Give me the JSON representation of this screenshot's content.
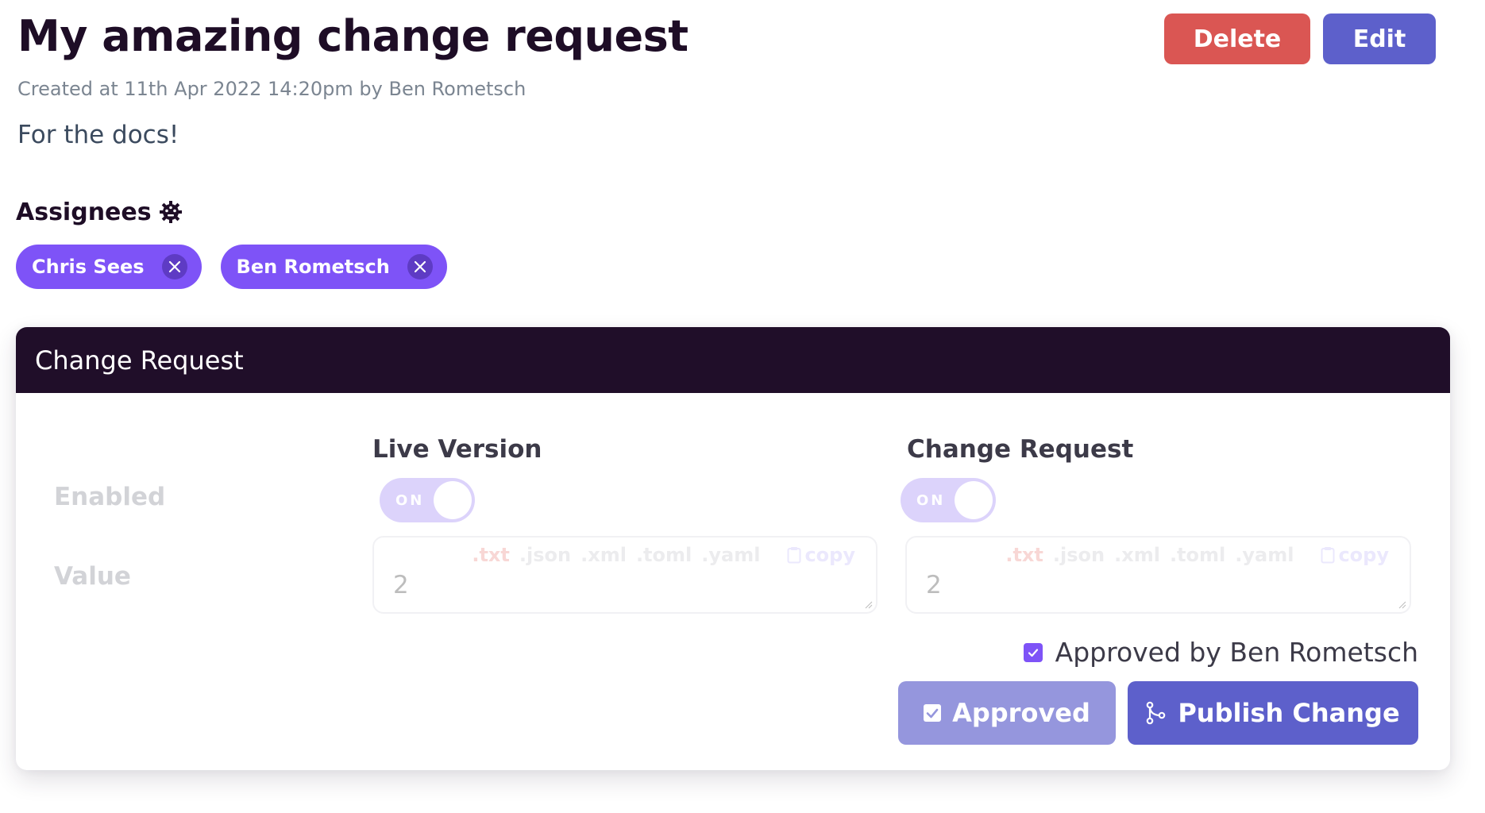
{
  "header": {
    "title": "My amazing change request",
    "created": "Created at 11th Apr 2022 14:20pm by Ben Rometsch",
    "description": "For the docs!",
    "delete_label": "Delete",
    "edit_label": "Edit"
  },
  "assignees": {
    "label": "Assignees",
    "settings_icon": "gear-icon",
    "people": [
      {
        "name": "Chris Sees"
      },
      {
        "name": "Ben Rometsch"
      }
    ]
  },
  "card": {
    "title": "Change Request",
    "rows": {
      "enabled_label": "Enabled",
      "value_label": "Value"
    },
    "live": {
      "heading": "Live Version",
      "toggle_label": "ON",
      "toggle_on": true,
      "value": "2"
    },
    "change": {
      "heading": "Change Request",
      "toggle_label": "ON",
      "toggle_on": true,
      "value": "2"
    },
    "formats": [
      ".txt",
      ".json",
      ".xml",
      ".toml",
      ".yaml"
    ],
    "copy_label": "copy",
    "approved_by": "Approved by Ben Rometsch",
    "approved_checked": true,
    "approved_button": "Approved",
    "publish_button": "Publish Change"
  },
  "colors": {
    "primary": "#5d60cb",
    "danger": "#da5653",
    "chip": "#7e53f7",
    "header_bg": "#200e29"
  }
}
